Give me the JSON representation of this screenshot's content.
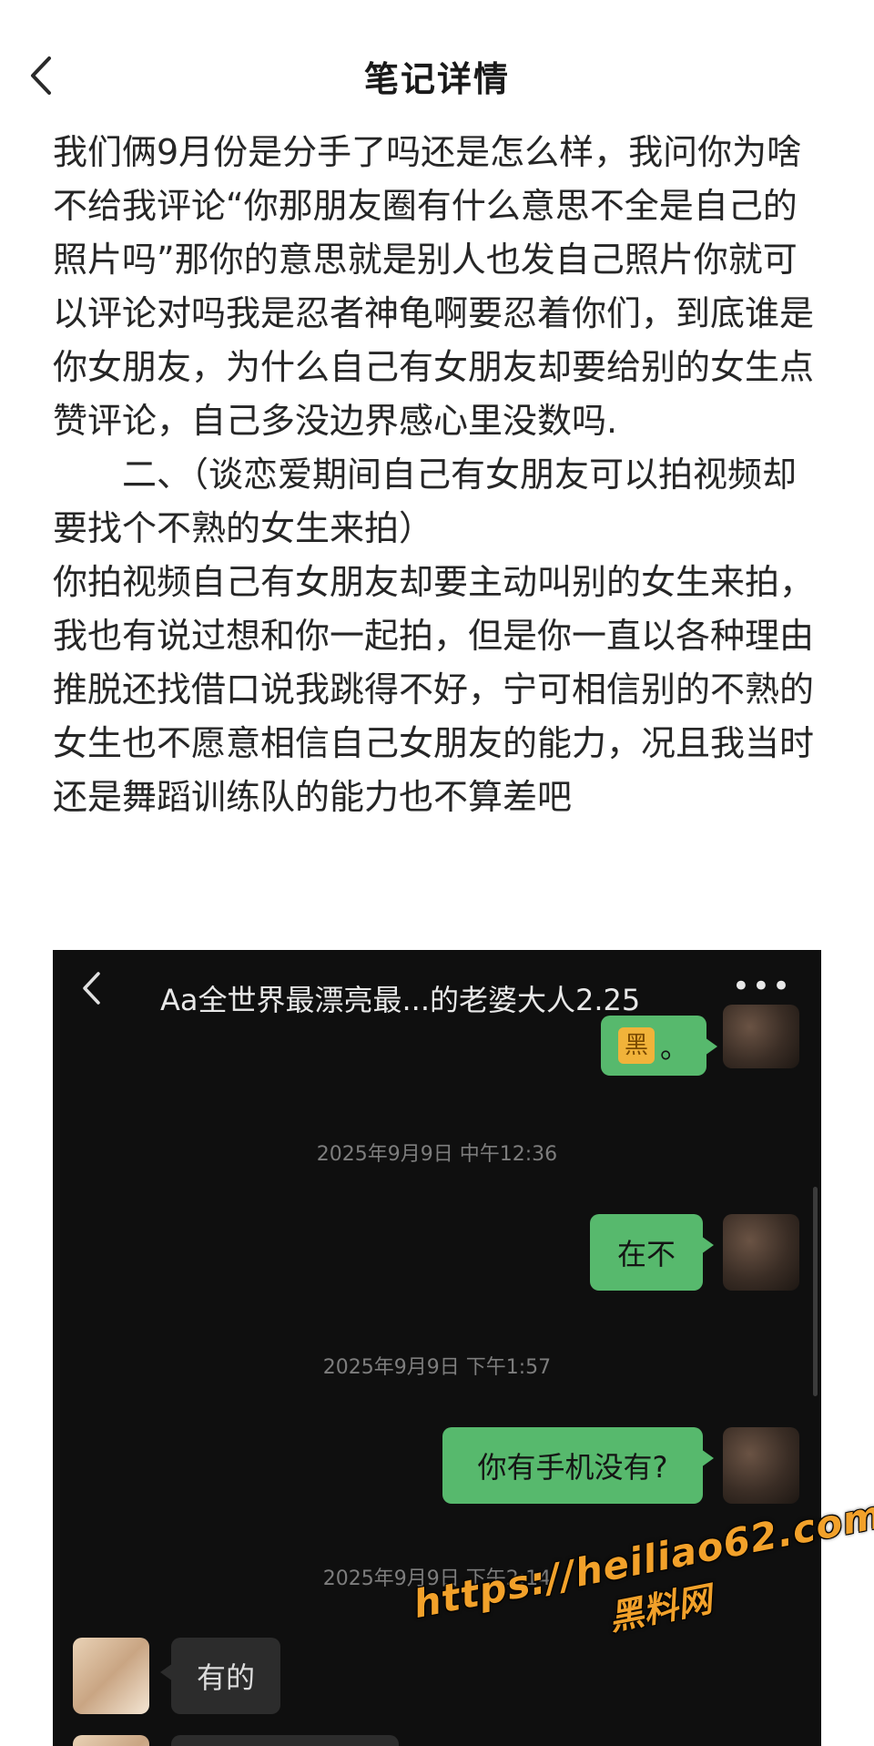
{
  "header": {
    "title": "笔记详情",
    "back_icon": "chevron-left-icon"
  },
  "note": {
    "paragraphs": [
      "我们俩9月份是分手了吗还是怎么样，我问你为啥不给我评论“你那朋友圈有什么意思不全是自己的照片吗”那你的意思就是别人也发自己照片你就可以评论对吗我是忍者神龟啊要忍着你们，到底谁是你女朋友，为什么自己有女朋友却要给别的女生点赞评论，自己多没边界感心里没数吗.",
      "二、（谈恋爱期间自己有女朋友可以拍视频却要找个不熟的女生来拍）",
      "你拍视频自己有女朋友却要主动叫别的女生来拍，我也有说过想和你一起拍，但是你一直以各种理由推脱还找借口说我跳得不好，宁可相信别的不熟的女生也不愿意相信自己女朋友的能力，况且我当时还是舞蹈训练队的能力也不算差吧"
    ]
  },
  "chat_screenshot": {
    "title": "Aa全世界最漂亮最...的老婆大人2.25",
    "more_icon": "more-dots-icon",
    "first_bubble_emoji": "黑",
    "first_bubble_tail": "。",
    "messages": [
      {
        "timestamp": "2025年9月9日 中午12:36",
        "text": "在不",
        "side": "right"
      },
      {
        "timestamp": "2025年9月9日 下午1:57",
        "text": "你有手机没有?",
        "side": "right"
      },
      {
        "timestamp": "2025年9月9日 下午2:14",
        "text": "有的",
        "side": "left"
      }
    ]
  },
  "watermark": {
    "url": "https://heiliao62.com",
    "name": "黑料网"
  },
  "colors": {
    "bubble_green": "#57b96d",
    "chat_background": "#0f0f0f",
    "watermark_orange": "#f2a12a"
  }
}
